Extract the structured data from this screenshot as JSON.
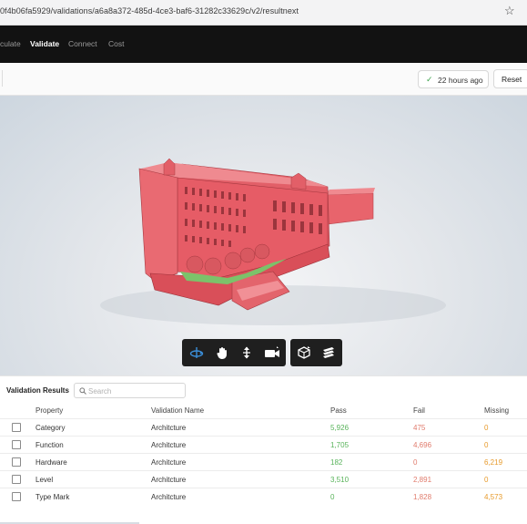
{
  "browser": {
    "url": "0f4b06fa5929/validations/a6a8a372-485d-4ce3-baf6-31282c33629c/v2/resultnext",
    "bookmark_icon": "star-icon"
  },
  "nav": {
    "items": [
      {
        "label": "culate",
        "active": false
      },
      {
        "label": "Validate",
        "active": true
      },
      {
        "label": "Connect",
        "active": false
      },
      {
        "label": "Cost",
        "active": false
      }
    ]
  },
  "toolbar": {
    "timestamp": "22 hours ago",
    "reset_label": "Reset"
  },
  "viewport": {
    "model_color": "#e8646c",
    "accent_color": "#3b8fd9",
    "tools": [
      "orbit-icon",
      "pan-icon",
      "vertical-move-icon",
      "camera-icon",
      "section-box-icon",
      "layers-icon"
    ]
  },
  "results": {
    "title": "Validation Results",
    "search_placeholder": "Search",
    "columns": [
      "Property",
      "Validation Name",
      "Pass",
      "Fail",
      "Missing"
    ],
    "rows": [
      {
        "property": "Category",
        "validation": "Architcture",
        "pass": "5,926",
        "fail": "475",
        "missing": "0"
      },
      {
        "property": "Function",
        "validation": "Architcture",
        "pass": "1,705",
        "fail": "4,696",
        "missing": "0"
      },
      {
        "property": "Hardware",
        "validation": "Architcture",
        "pass": "182",
        "fail": "0",
        "missing": "6,219"
      },
      {
        "property": "Level",
        "validation": "Architcture",
        "pass": "3,510",
        "fail": "2,891",
        "missing": "0"
      },
      {
        "property": "Type Mark",
        "validation": "Architcture",
        "pass": "0",
        "fail": "1,828",
        "missing": "4,573"
      }
    ]
  }
}
